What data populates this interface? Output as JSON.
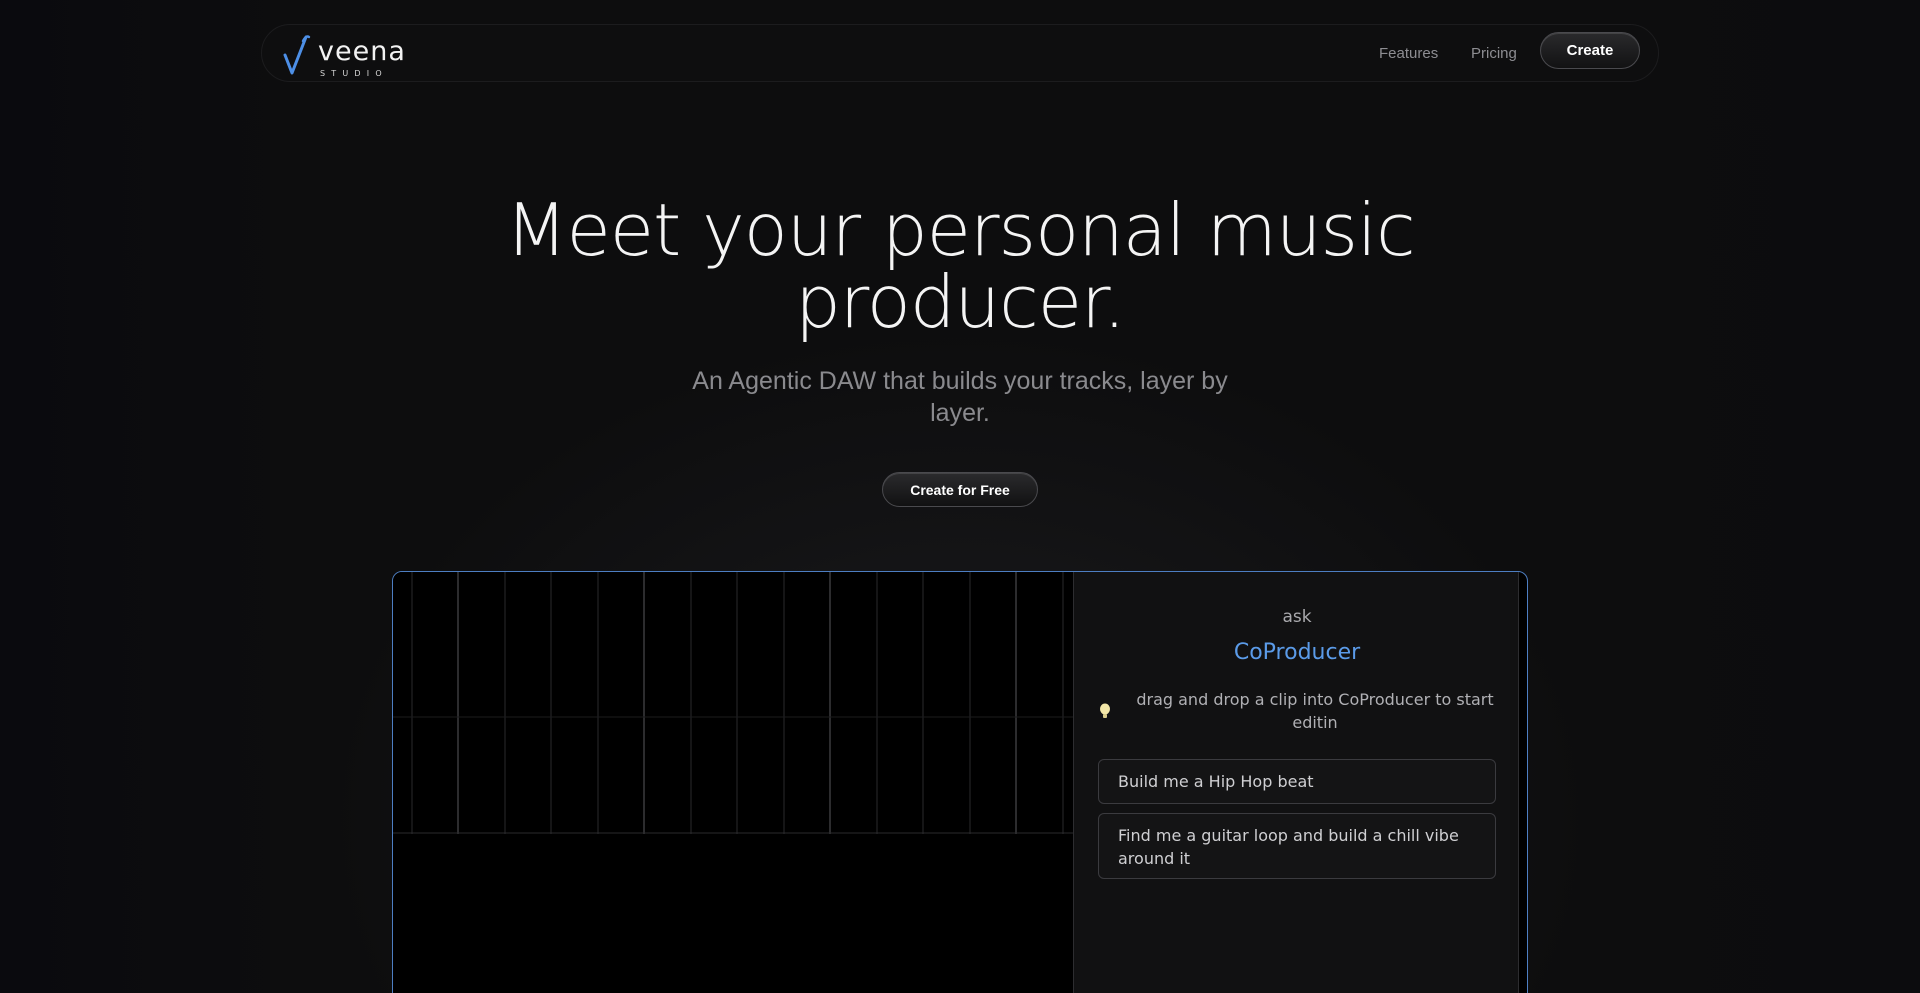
{
  "brand": {
    "name": "veena",
    "tagline": "STUDIO",
    "accent": "#4d8fe6"
  },
  "nav": {
    "features": "Features",
    "pricing": "Pricing",
    "create": "Create"
  },
  "hero": {
    "title_line1": "Meet your personal music",
    "title_line2": "producer.",
    "subtitle": "An Agentic DAW that builds your tracks, layer by layer.",
    "cta": "Create for Free"
  },
  "coproducer": {
    "ask": "ask",
    "title": "CoProducer",
    "tip": "drag and drop a clip into CoProducer to start editin",
    "tip_icon": "lightbulb-icon",
    "suggestions": [
      "Build me a Hip Hop beat",
      "Find me a guitar loop and build a chill vibe around it"
    ]
  },
  "colors": {
    "background": "#0c0c0d",
    "frame_border": "#4d7ec2",
    "coproducer_title": "#5b9be8"
  }
}
